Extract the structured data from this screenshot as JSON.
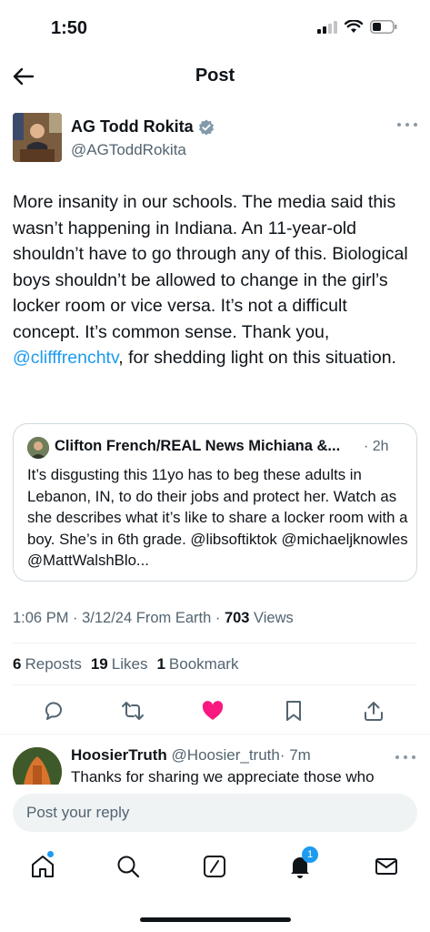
{
  "status_bar": {
    "time": "1:50"
  },
  "header": {
    "title": "Post"
  },
  "post": {
    "author_name": "AG Todd Rokita",
    "author_handle": "@AGToddRokita",
    "text_before_mention": "More insanity in our schools. The media said this wasn’t happening in Indiana. An 11-year-old shouldn’t have to go through any of this. Biological boys shouldn’t be allowed to change in the girl’s locker room or vice versa. It’s not a difficult concept. It’s common sense. Thank you, ",
    "mention": "@clifffrenchtv",
    "text_after_mention": ", for shedding light on this situation.",
    "quote": {
      "author": "Clifton French/REAL News Michiana &...",
      "time": "· 2h",
      "text": "It’s disgusting this 11yo has to beg these adults in Lebanon, IN, to do their jobs and protect her. Watch as she describes what it’s like to share a locker room with a boy. She’s in 6th grade. @libsoftiktok @michaeljknowles @MattWalshBlo..."
    },
    "meta_prefix": "1:06 PM · 3/12/24 From Earth · ",
    "views_count": "703",
    "views_label": " Views",
    "stats": {
      "reposts_count": "6",
      "reposts_label": "Reposts",
      "likes_count": "19",
      "likes_label": "Likes",
      "bookmarks_count": "1",
      "bookmarks_label": "Bookmark"
    },
    "liked": true,
    "accent_color": "#1d9bf0",
    "like_color": "#f91880"
  },
  "reply": {
    "author_name": "HoosierTruth",
    "author_handle": "@Hoosier_truth",
    "time": "· 7m",
    "text": "Thanks for sharing we appreciate those who"
  },
  "reply_bar": {
    "placeholder": "Post your reply"
  },
  "tabbar": {
    "items": [
      "home-icon",
      "search-icon",
      "grok-icon",
      "notifications-icon",
      "messages-icon"
    ],
    "notifications_badge": "1"
  }
}
